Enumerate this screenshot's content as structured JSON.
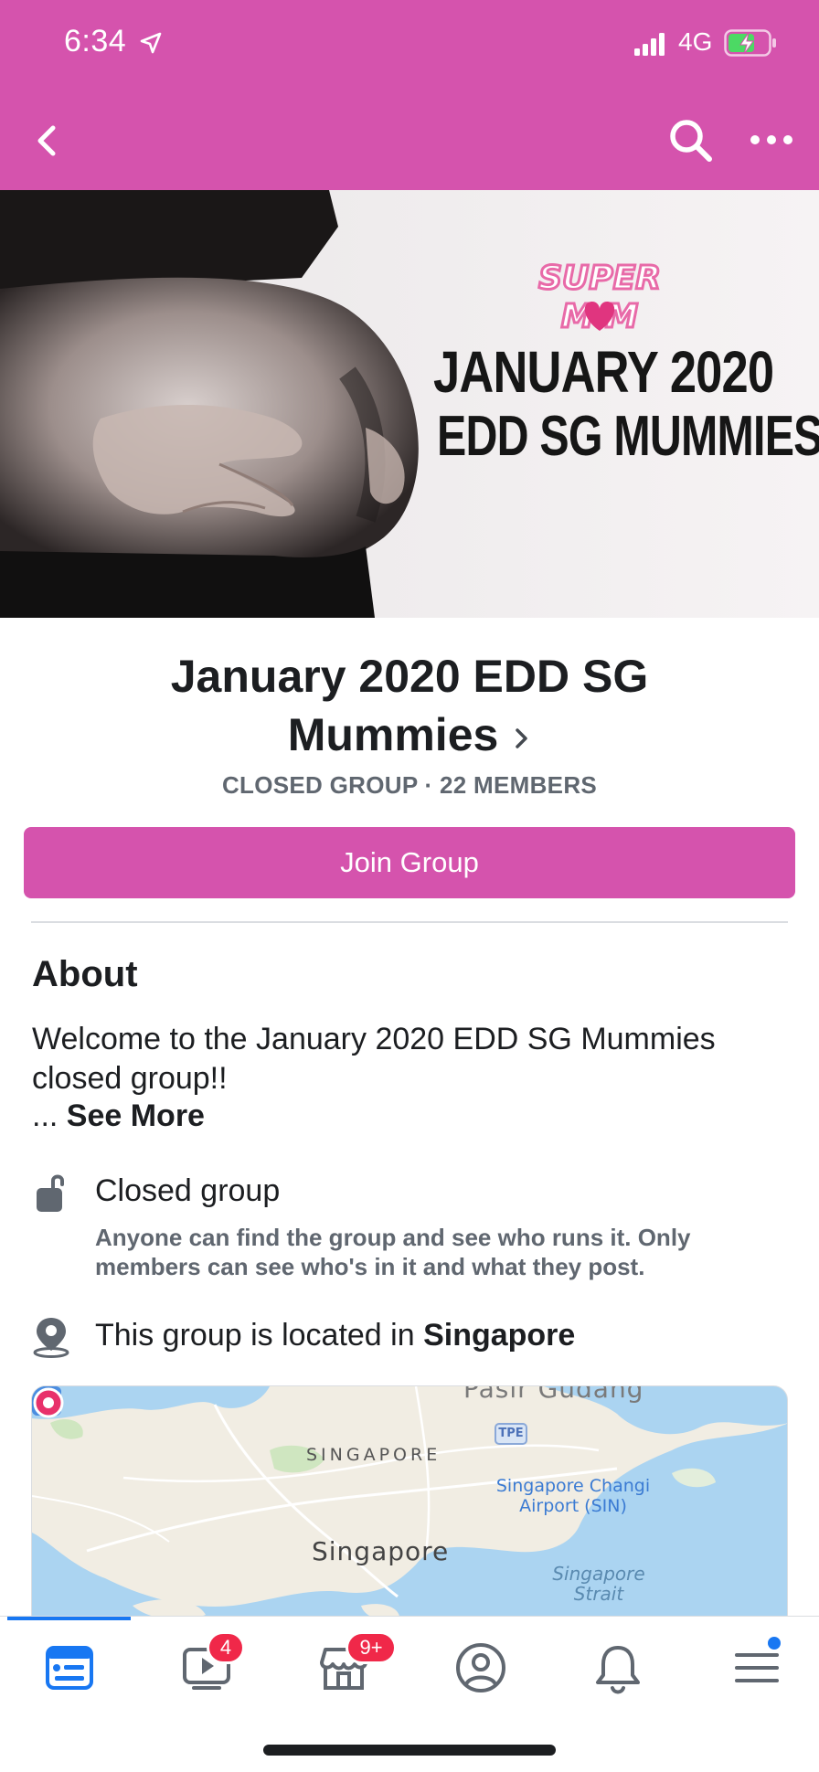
{
  "status_bar": {
    "time": "6:34",
    "network": "4G",
    "icons": [
      "location-arrow-icon",
      "signal-bars-icon",
      "battery-charging-icon"
    ]
  },
  "nav": {
    "icons": [
      "back-chevron-icon",
      "search-icon",
      "more-dots-icon"
    ],
    "background_color": "#d553ad"
  },
  "cover": {
    "badge_line1": "SUPER",
    "badge_line2": "MOM",
    "headline_line1": "JANUARY 2020",
    "headline_line2": "EDD SG MUMMIES"
  },
  "group": {
    "name": "January 2020 EDD SG Mummies",
    "meta": "CLOSED GROUP · 22 MEMBERS",
    "join_label": "Join Group"
  },
  "about": {
    "heading": "About",
    "description": "Welcome to the January 2020 EDD SG Mummies closed group!!",
    "see_more_prefix": "... ",
    "see_more": "See More",
    "privacy_title": "Closed group",
    "privacy_description": "Anyone can find the group and see who runs it. Only members can see who's in it and what they post.",
    "location_prefix": "This group is located in ",
    "location": "Singapore"
  },
  "map": {
    "labels": {
      "pasir": "Pasir Gudang",
      "sg_caps": "SINGAPORE",
      "airport": "Singapore Changi Airport (SIN)",
      "singapore": "Singapore",
      "strait": "Singapore Strait",
      "tpe": "TPE"
    }
  },
  "tabbar": {
    "tabs": [
      {
        "icon": "news-feed-icon",
        "active": true
      },
      {
        "icon": "watch-icon",
        "badge": "4"
      },
      {
        "icon": "marketplace-icon",
        "badge": "9+"
      },
      {
        "icon": "profile-icon"
      },
      {
        "icon": "notifications-bell-icon"
      },
      {
        "icon": "menu-icon"
      }
    ],
    "active_color": "#1877f2",
    "badge_color": "#f02849"
  }
}
